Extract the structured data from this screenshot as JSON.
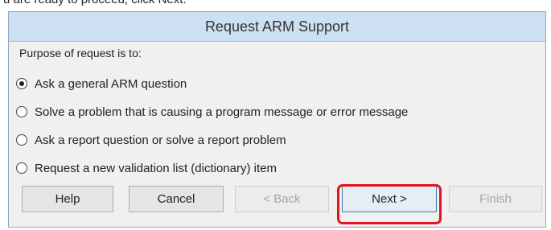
{
  "header_text": "u are ready to proceed, click Next.",
  "dialog": {
    "title": "Request ARM Support",
    "group_label": "Purpose of request is to:",
    "options": [
      {
        "label": "Ask a general ARM question",
        "checked": true
      },
      {
        "label": "Solve a problem that is causing a program message or error message",
        "checked": false
      },
      {
        "label": "Ask a report question or solve a report problem",
        "checked": false
      },
      {
        "label": "Request a new validation list (dictionary) item",
        "checked": false
      }
    ],
    "buttons": {
      "help": "Help",
      "cancel": "Cancel",
      "back": "< Back",
      "next": "Next >",
      "finish": "Finish"
    },
    "highlight_color": "#e3141b"
  }
}
